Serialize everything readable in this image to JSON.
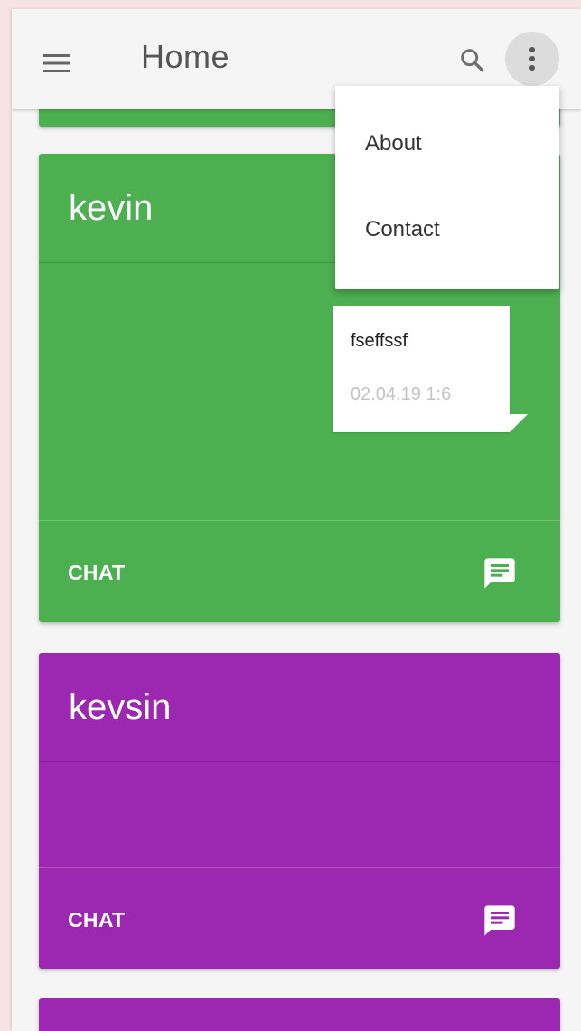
{
  "toolbar": {
    "title": "Home",
    "menu_icon": "hamburger-menu-icon",
    "search_icon": "search-icon",
    "more_icon": "more-vertical-icon"
  },
  "dropdown": {
    "items": [
      {
        "label": "About"
      },
      {
        "label": "Contact"
      }
    ]
  },
  "cards": [
    {
      "name": "kevin",
      "color": "#4caf50",
      "messages": [
        {
          "text": "fseffssf",
          "time": "02.04.19 1:6"
        }
      ],
      "action_label": "CHAT",
      "action_icon": "chat-icon"
    },
    {
      "name": "kevsin",
      "color": "#9c27b0",
      "messages": [],
      "action_label": "CHAT",
      "action_icon": "chat-icon"
    }
  ],
  "colors": {
    "background": "#f5f5f5",
    "toolbar_text": "#555555",
    "green_card": "#4caf50",
    "purple_card": "#9c27b0"
  }
}
